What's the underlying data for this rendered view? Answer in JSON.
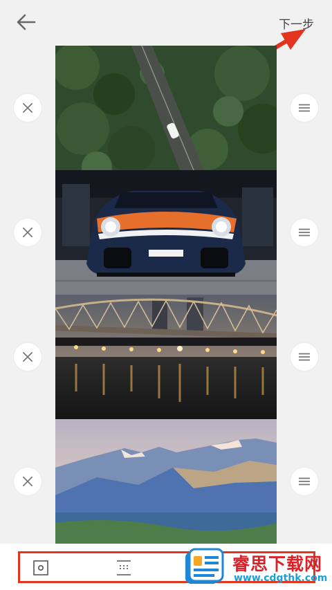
{
  "header": {
    "back_icon": "arrow-left-icon",
    "next_label": "下一步"
  },
  "colors": {
    "annotation": "#e3341e",
    "background": "#f1f1f1"
  },
  "photos": [
    {
      "subject": "forest-road-aerial",
      "remove_icon": "close-icon",
      "reorder_icon": "drag-handle-icon"
    },
    {
      "subject": "race-car",
      "remove_icon": "close-icon",
      "reorder_icon": "drag-handle-icon"
    },
    {
      "subject": "bridge-night",
      "remove_icon": "close-icon",
      "reorder_icon": "drag-handle-icon"
    },
    {
      "subject": "mountain-landscape",
      "remove_icon": "close-icon",
      "reorder_icon": "drag-handle-icon"
    }
  ],
  "toolbar": {
    "tools": [
      "frame-icon",
      "fit-icon"
    ]
  },
  "watermark": {
    "title": "睿思下载网",
    "url": "www.cdgthk.com"
  }
}
